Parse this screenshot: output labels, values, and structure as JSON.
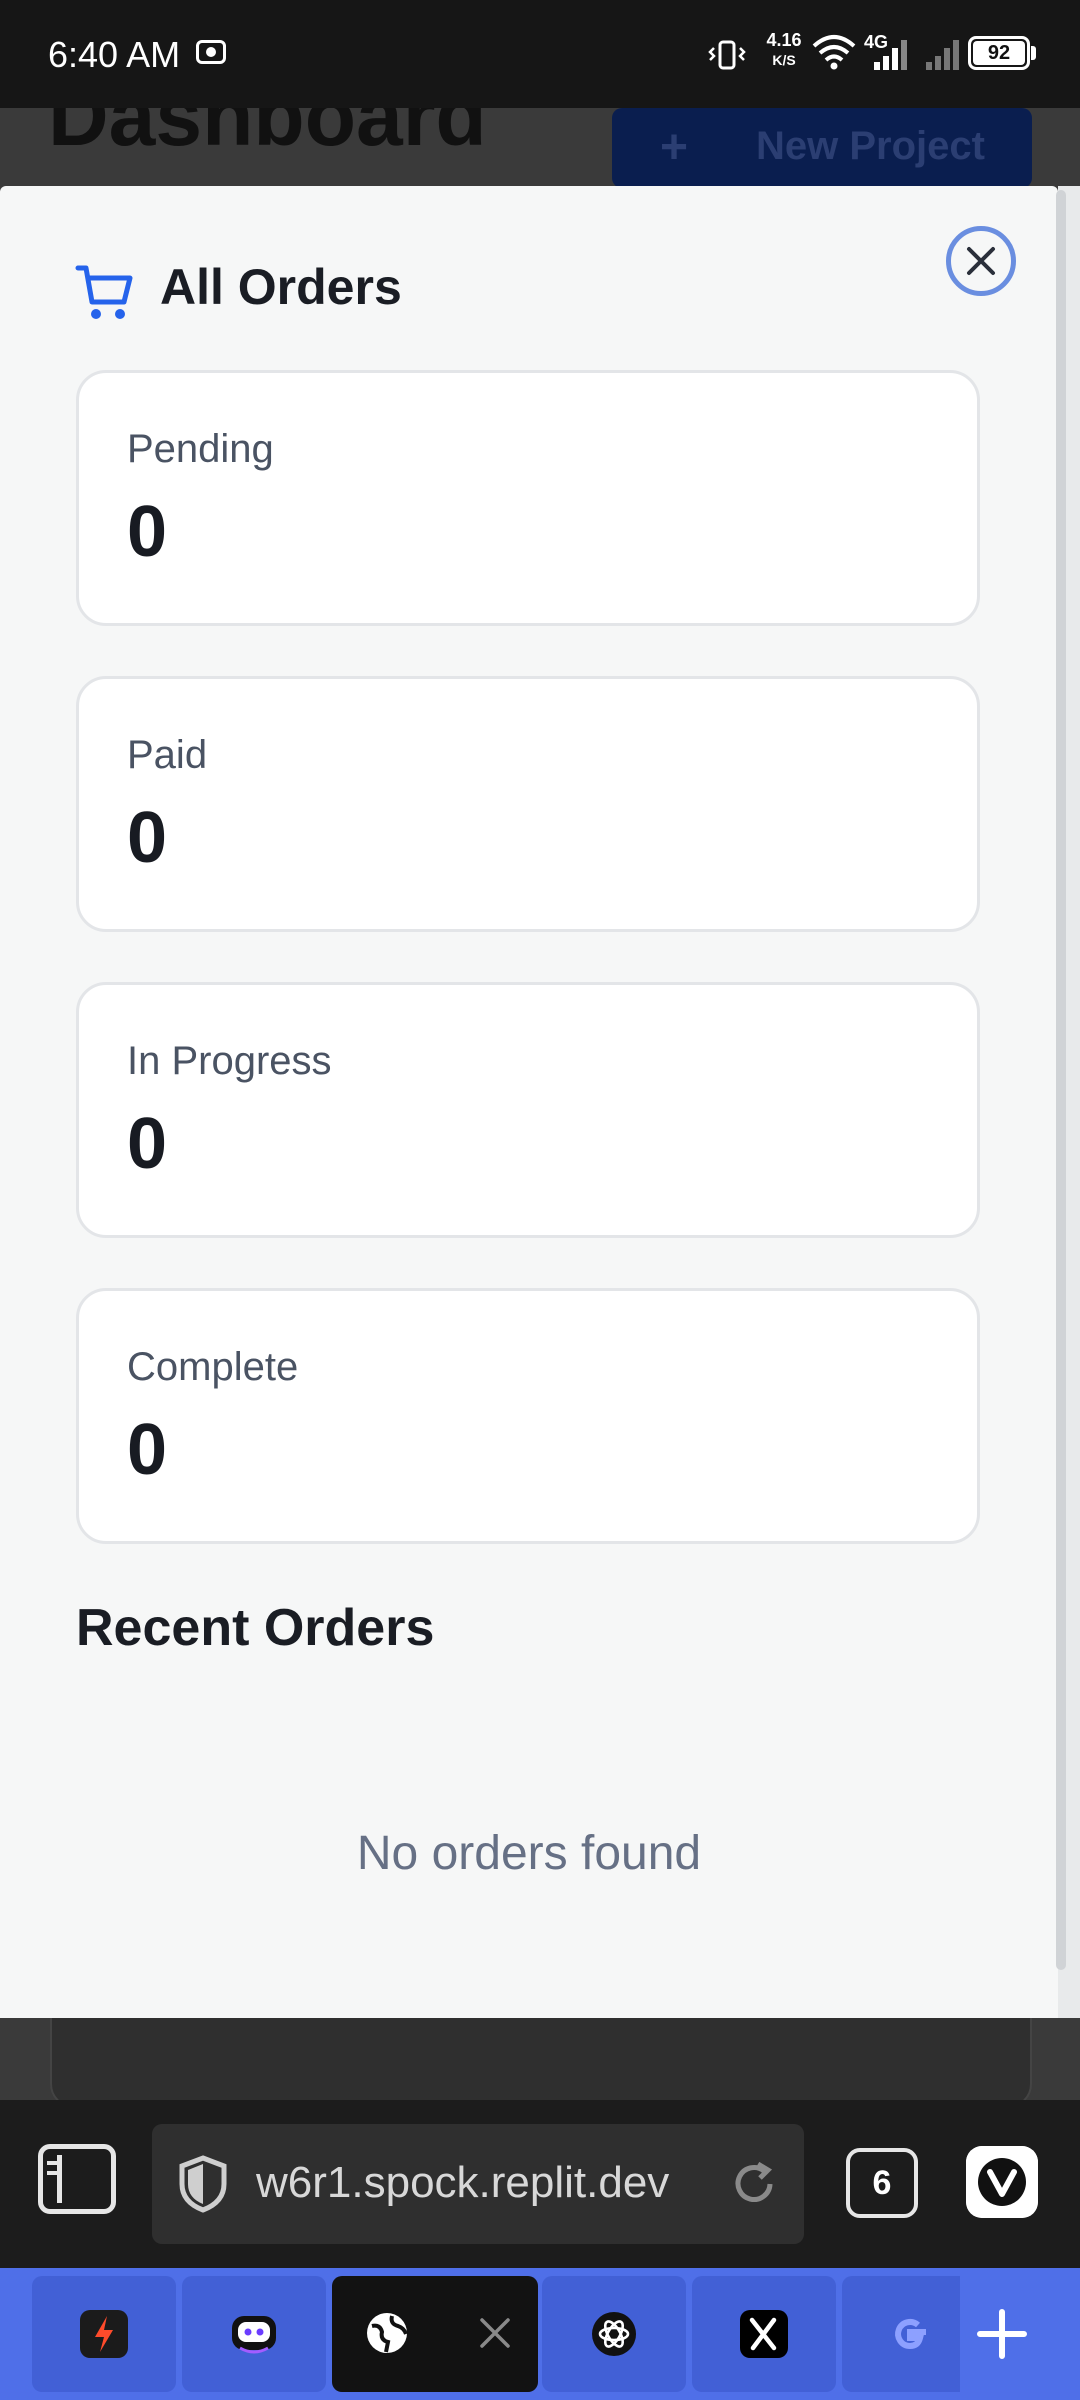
{
  "status_bar": {
    "time": "6:40 AM",
    "network_speed_value": "4.16",
    "network_speed_unit": "K/S",
    "network_type": "4G",
    "battery": "92"
  },
  "background_page": {
    "title": "Dashboard",
    "new_project_label": "New Project"
  },
  "modal": {
    "title": "All Orders",
    "title_icon": "shopping-cart-icon",
    "close_icon": "close-icon",
    "accent_color": "#2563eb",
    "stats": [
      {
        "label": "Pending",
        "value": "0"
      },
      {
        "label": "Paid",
        "value": "0"
      },
      {
        "label": "In Progress",
        "value": "0"
      },
      {
        "label": "Complete",
        "value": "0"
      }
    ],
    "recent_heading": "Recent Orders",
    "empty_message": "No orders found"
  },
  "browser": {
    "url": "w6r1.spock.replit.dev",
    "tab_count": "6",
    "tab_bar_color": "#4f6fe8"
  },
  "tabs": [
    {
      "icon": "bolt-app-icon"
    },
    {
      "icon": "robot-chat-icon"
    },
    {
      "icon": "globe-icon",
      "active": true
    },
    {
      "icon": "openai-icon"
    },
    {
      "icon": "x-logo-icon"
    },
    {
      "icon": "google-icon"
    }
  ]
}
